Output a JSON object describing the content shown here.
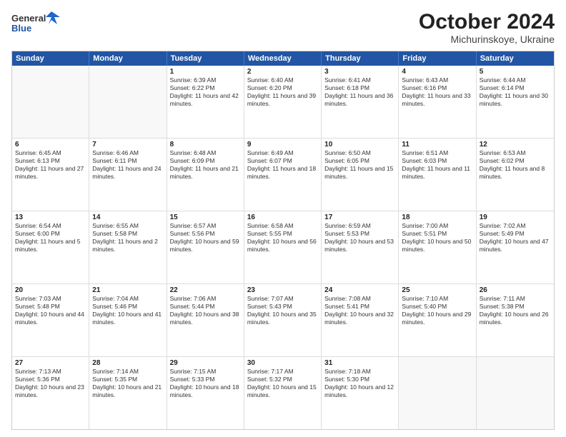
{
  "logo": {
    "line1": "General",
    "line2": "Blue"
  },
  "title": "October 2024",
  "subtitle": "Michurinskoye, Ukraine",
  "days": [
    "Sunday",
    "Monday",
    "Tuesday",
    "Wednesday",
    "Thursday",
    "Friday",
    "Saturday"
  ],
  "rows": [
    [
      {
        "day": "",
        "info": ""
      },
      {
        "day": "",
        "info": ""
      },
      {
        "day": "1",
        "info": "Sunrise: 6:39 AM\nSunset: 6:22 PM\nDaylight: 11 hours and 42 minutes."
      },
      {
        "day": "2",
        "info": "Sunrise: 6:40 AM\nSunset: 6:20 PM\nDaylight: 11 hours and 39 minutes."
      },
      {
        "day": "3",
        "info": "Sunrise: 6:41 AM\nSunset: 6:18 PM\nDaylight: 11 hours and 36 minutes."
      },
      {
        "day": "4",
        "info": "Sunrise: 6:43 AM\nSunset: 6:16 PM\nDaylight: 11 hours and 33 minutes."
      },
      {
        "day": "5",
        "info": "Sunrise: 6:44 AM\nSunset: 6:14 PM\nDaylight: 11 hours and 30 minutes."
      }
    ],
    [
      {
        "day": "6",
        "info": "Sunrise: 6:45 AM\nSunset: 6:13 PM\nDaylight: 11 hours and 27 minutes."
      },
      {
        "day": "7",
        "info": "Sunrise: 6:46 AM\nSunset: 6:11 PM\nDaylight: 11 hours and 24 minutes."
      },
      {
        "day": "8",
        "info": "Sunrise: 6:48 AM\nSunset: 6:09 PM\nDaylight: 11 hours and 21 minutes."
      },
      {
        "day": "9",
        "info": "Sunrise: 6:49 AM\nSunset: 6:07 PM\nDaylight: 11 hours and 18 minutes."
      },
      {
        "day": "10",
        "info": "Sunrise: 6:50 AM\nSunset: 6:05 PM\nDaylight: 11 hours and 15 minutes."
      },
      {
        "day": "11",
        "info": "Sunrise: 6:51 AM\nSunset: 6:03 PM\nDaylight: 11 hours and 11 minutes."
      },
      {
        "day": "12",
        "info": "Sunrise: 6:53 AM\nSunset: 6:02 PM\nDaylight: 11 hours and 8 minutes."
      }
    ],
    [
      {
        "day": "13",
        "info": "Sunrise: 6:54 AM\nSunset: 6:00 PM\nDaylight: 11 hours and 5 minutes."
      },
      {
        "day": "14",
        "info": "Sunrise: 6:55 AM\nSunset: 5:58 PM\nDaylight: 11 hours and 2 minutes."
      },
      {
        "day": "15",
        "info": "Sunrise: 6:57 AM\nSunset: 5:56 PM\nDaylight: 10 hours and 59 minutes."
      },
      {
        "day": "16",
        "info": "Sunrise: 6:58 AM\nSunset: 5:55 PM\nDaylight: 10 hours and 56 minutes."
      },
      {
        "day": "17",
        "info": "Sunrise: 6:59 AM\nSunset: 5:53 PM\nDaylight: 10 hours and 53 minutes."
      },
      {
        "day": "18",
        "info": "Sunrise: 7:00 AM\nSunset: 5:51 PM\nDaylight: 10 hours and 50 minutes."
      },
      {
        "day": "19",
        "info": "Sunrise: 7:02 AM\nSunset: 5:49 PM\nDaylight: 10 hours and 47 minutes."
      }
    ],
    [
      {
        "day": "20",
        "info": "Sunrise: 7:03 AM\nSunset: 5:48 PM\nDaylight: 10 hours and 44 minutes."
      },
      {
        "day": "21",
        "info": "Sunrise: 7:04 AM\nSunset: 5:46 PM\nDaylight: 10 hours and 41 minutes."
      },
      {
        "day": "22",
        "info": "Sunrise: 7:06 AM\nSunset: 5:44 PM\nDaylight: 10 hours and 38 minutes."
      },
      {
        "day": "23",
        "info": "Sunrise: 7:07 AM\nSunset: 5:43 PM\nDaylight: 10 hours and 35 minutes."
      },
      {
        "day": "24",
        "info": "Sunrise: 7:08 AM\nSunset: 5:41 PM\nDaylight: 10 hours and 32 minutes."
      },
      {
        "day": "25",
        "info": "Sunrise: 7:10 AM\nSunset: 5:40 PM\nDaylight: 10 hours and 29 minutes."
      },
      {
        "day": "26",
        "info": "Sunrise: 7:11 AM\nSunset: 5:38 PM\nDaylight: 10 hours and 26 minutes."
      }
    ],
    [
      {
        "day": "27",
        "info": "Sunrise: 7:13 AM\nSunset: 5:36 PM\nDaylight: 10 hours and 23 minutes."
      },
      {
        "day": "28",
        "info": "Sunrise: 7:14 AM\nSunset: 5:35 PM\nDaylight: 10 hours and 21 minutes."
      },
      {
        "day": "29",
        "info": "Sunrise: 7:15 AM\nSunset: 5:33 PM\nDaylight: 10 hours and 18 minutes."
      },
      {
        "day": "30",
        "info": "Sunrise: 7:17 AM\nSunset: 5:32 PM\nDaylight: 10 hours and 15 minutes."
      },
      {
        "day": "31",
        "info": "Sunrise: 7:18 AM\nSunset: 5:30 PM\nDaylight: 10 hours and 12 minutes."
      },
      {
        "day": "",
        "info": ""
      },
      {
        "day": "",
        "info": ""
      }
    ]
  ]
}
